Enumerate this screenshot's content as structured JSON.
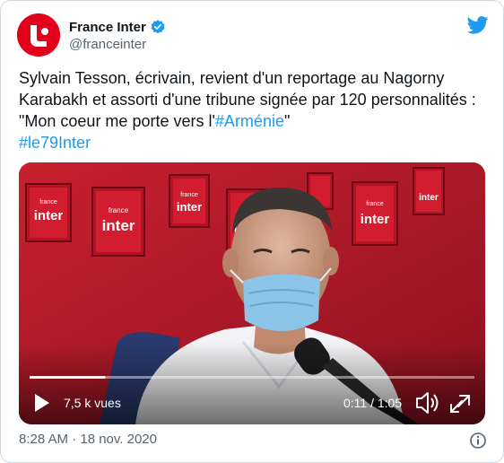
{
  "account": {
    "display_name": "France Inter",
    "handle": "@franceinter"
  },
  "tweet": {
    "text_part1": "Sylvain Tesson, écrivain, revient d'un reportage au Nagorny Karabakh et assorti d'une tribune signée par 120 personnalités : \"Mon coeur me porte vers l'",
    "hashtag1": "#Arménie",
    "text_part2": "\"",
    "hashtag2": "#le79Inter"
  },
  "video": {
    "views": "7,5 k vues",
    "time": "0:11 / 1:05",
    "progress_fraction": 0.17,
    "studio_logo_text": "inter",
    "studio_logo_small": "france"
  },
  "footer": {
    "timestamp": "8:28 AM · 18 nov. 2020"
  },
  "colors": {
    "brand_red": "#e2001a",
    "link_blue": "#1d9bf0",
    "twitter_blue": "#1d9bf0"
  },
  "icons": [
    "verified-badge-icon",
    "twitter-bird-icon",
    "play-icon",
    "volume-icon",
    "fullscreen-icon",
    "info-icon"
  ]
}
